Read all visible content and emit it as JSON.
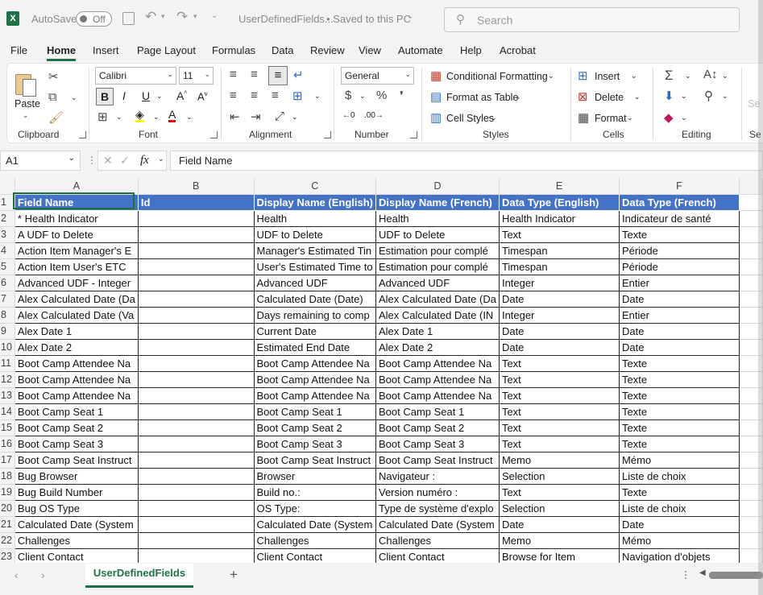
{
  "titlebar": {
    "autosave_label": "AutoSave",
    "autosave_state": "Off",
    "filename": "UserDefinedFields...",
    "save_status": "• Saved to this PC",
    "search_placeholder": "Search"
  },
  "menu": [
    "File",
    "Home",
    "Insert",
    "Page Layout",
    "Formulas",
    "Data",
    "Review",
    "View",
    "Automate",
    "Help",
    "Acrobat"
  ],
  "ribbon": {
    "clipboard": {
      "paste": "Paste",
      "label": "Clipboard"
    },
    "font": {
      "name": "Calibri",
      "size": "11",
      "label": "Font"
    },
    "alignment": {
      "label": "Alignment"
    },
    "number": {
      "format": "General",
      "label": "Number"
    },
    "styles": {
      "conditional": "Conditional Formatting",
      "table": "Format as Table",
      "cell": "Cell Styles",
      "label": "Styles"
    },
    "cells": {
      "insert": "Insert",
      "delete": "Delete",
      "format": "Format",
      "label": "Cells"
    },
    "editing": {
      "label": "Editing"
    },
    "cutoff1": "Se",
    "cutoff2": "Se"
  },
  "formula_bar": {
    "name_box": "A1",
    "fx": "fx",
    "formula": "Field Name"
  },
  "columns": [
    "A",
    "B",
    "C",
    "D",
    "E",
    "F"
  ],
  "header": [
    "Field Name",
    "Id",
    "Display Name (English)",
    "Display Name (French)",
    "Data Type (English)",
    "Data Type (French)"
  ],
  "rows": [
    [
      "* Health Indicator",
      "",
      "Health",
      "Health",
      "Health Indicator",
      "Indicateur de santé"
    ],
    [
      "A UDF to Delete",
      "",
      "UDF to Delete",
      "UDF to Delete",
      "Text",
      "Texte"
    ],
    [
      "Action Item Manager's E",
      "",
      "Manager's Estimated Tin",
      "Estimation pour complé",
      "Timespan",
      "Période"
    ],
    [
      "Action Item User's ETC",
      "",
      "User's Estimated Time to",
      "Estimation pour complé",
      "Timespan",
      "Période"
    ],
    [
      "Advanced UDF - Integer",
      "",
      "Advanced UDF",
      "Advanced UDF",
      "Integer",
      "Entier"
    ],
    [
      "Alex Calculated Date (Da",
      "",
      "Calculated Date (Date)",
      "Alex Calculated Date (Da",
      "Date",
      "Date"
    ],
    [
      "Alex Calculated Date (Va",
      "",
      "Days remaining to comp",
      "Alex Calculated Date (IN",
      "Integer",
      "Entier"
    ],
    [
      "Alex Date 1",
      "",
      "Current Date",
      "Alex Date 1",
      "Date",
      "Date"
    ],
    [
      "Alex Date 2",
      "",
      "Estimated End Date",
      "Alex Date 2",
      "Date",
      "Date"
    ],
    [
      "Boot Camp Attendee Na",
      "",
      "Boot Camp Attendee Na",
      "Boot Camp Attendee Na",
      "Text",
      "Texte"
    ],
    [
      "Boot Camp Attendee Na",
      "",
      "Boot Camp Attendee Na",
      "Boot Camp Attendee Na",
      "Text",
      "Texte"
    ],
    [
      "Boot Camp Attendee Na",
      "",
      "Boot Camp Attendee Na",
      "Boot Camp Attendee Na",
      "Text",
      "Texte"
    ],
    [
      "Boot Camp Seat 1",
      "",
      "Boot Camp Seat 1",
      "Boot Camp Seat 1",
      "Text",
      "Texte"
    ],
    [
      "Boot Camp Seat 2",
      "",
      "Boot Camp Seat 2",
      "Boot Camp Seat 2",
      "Text",
      "Texte"
    ],
    [
      "Boot Camp Seat 3",
      "",
      "Boot Camp Seat 3",
      "Boot Camp Seat 3",
      "Text",
      "Texte"
    ],
    [
      "Boot Camp Seat Instruct",
      "",
      "Boot Camp Seat Instruct",
      "Boot Camp Seat Instruct",
      "Memo",
      "Mémo"
    ],
    [
      "Bug Browser",
      "",
      "Browser",
      "Navigateur :",
      "Selection",
      "Liste de choix"
    ],
    [
      "Bug Build Number",
      "",
      "Build no.:",
      "Version numéro :",
      "Text",
      "Texte"
    ],
    [
      "Bug OS Type",
      "",
      "OS Type:",
      "Type de système d'explo",
      "Selection",
      "Liste de choix"
    ],
    [
      "Calculated Date (System",
      "",
      "Calculated Date (System",
      "Calculated Date (System",
      "Date",
      "Date"
    ],
    [
      "Challenges",
      "",
      "Challenges",
      "Challenges",
      "Memo",
      "Mémo"
    ],
    [
      "Client Contact",
      "",
      "Client Contact",
      "Client Contact",
      "Browse for Item",
      "Navigation d'objets"
    ]
  ],
  "sheet_tab": "UserDefinedFields",
  "add_sheet": "+",
  "accent": "#1e7145",
  "header_fill": "#4472c4"
}
